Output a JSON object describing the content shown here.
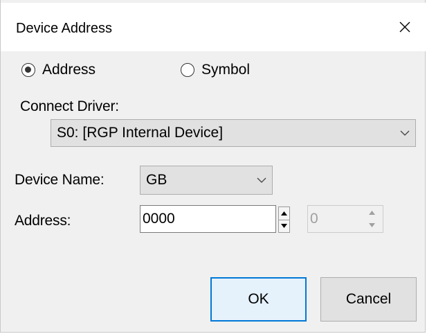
{
  "dialog": {
    "title": "Device Address",
    "close_icon": "close-icon"
  },
  "mode": {
    "options": [
      {
        "label": "Address",
        "checked": true
      },
      {
        "label": "Symbol",
        "checked": false
      }
    ]
  },
  "connect_driver": {
    "label": "Connect Driver:",
    "selected": "S0: [RGP Internal Device]"
  },
  "device_name": {
    "label": "Device Name:",
    "selected": "GB"
  },
  "address": {
    "label": "Address:",
    "value": "0000",
    "bit_value": "0"
  },
  "buttons": {
    "ok": "OK",
    "cancel": "Cancel"
  },
  "colors": {
    "accent": "#0078d7",
    "dialog_bg": "#f0f0f0",
    "button_bg": "#e1e1e1"
  }
}
